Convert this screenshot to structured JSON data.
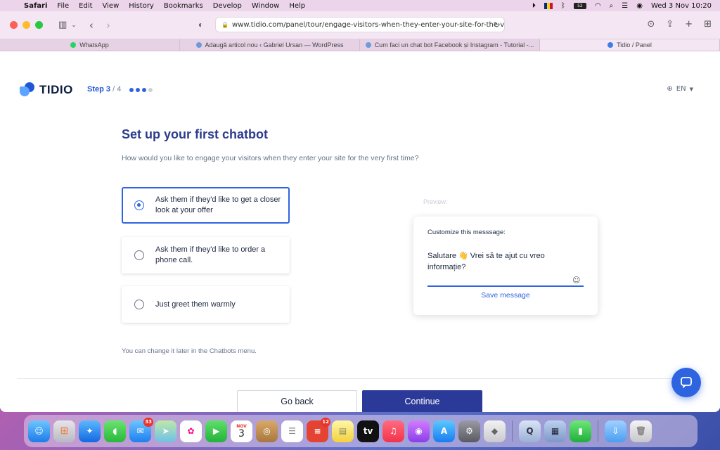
{
  "menubar": {
    "items": [
      "Safari",
      "File",
      "Edit",
      "View",
      "History",
      "Bookmarks",
      "Develop",
      "Window",
      "Help"
    ],
    "battery": "52",
    "clock": "Wed 3 Nov  10:20"
  },
  "browser": {
    "url": "www.tidio.com/panel/tour/engage-visitors-when-they-enter-your-site-for-the-very-",
    "tabs": [
      {
        "title": "WhatsApp",
        "color": "#25d366"
      },
      {
        "title": "Adaugă articol nou ‹ Gabriel Ursan — WordPress",
        "color": "#6e9bd8"
      },
      {
        "title": "Cum faci un chat bot Facebook și Instagram - Tutorial -...",
        "color": "#6e9bd8"
      },
      {
        "title": "Tidio / Panel",
        "color": "#3f7de6"
      }
    ]
  },
  "header": {
    "logo": "TIDIO",
    "step_label": "Step 3",
    "step_total": "/ 4",
    "language": "EN"
  },
  "main": {
    "title": "Set up your first chatbot",
    "subtitle": "How would you like to engage your visitors when they enter your site for the very first time?",
    "options": [
      {
        "label": "Ask them if they'd like to get a closer look at your offer",
        "selected": true
      },
      {
        "label": "Ask them if they'd like to order a phone call.",
        "selected": false
      },
      {
        "label": "Just greet them warmly",
        "selected": false
      }
    ],
    "hint": "You can change it later in the Chatbots menu."
  },
  "preview": {
    "label": "Preview:",
    "caption": "Customize this messsage:",
    "message": "Salutare 👋 Vrei să te ajut cu vreo informație?",
    "save_label": "Save message"
  },
  "footer": {
    "back_label": "Go back",
    "continue_label": "Continue"
  },
  "dock": {
    "mail_badge": "33",
    "calendar_month": "NOV",
    "calendar_day": "3",
    "todoist_badge": "12",
    "tv_label": "tv"
  },
  "colors": {
    "accent": "#2f64e0",
    "title": "#2c3b8e",
    "continue": "#2b3a98"
  }
}
